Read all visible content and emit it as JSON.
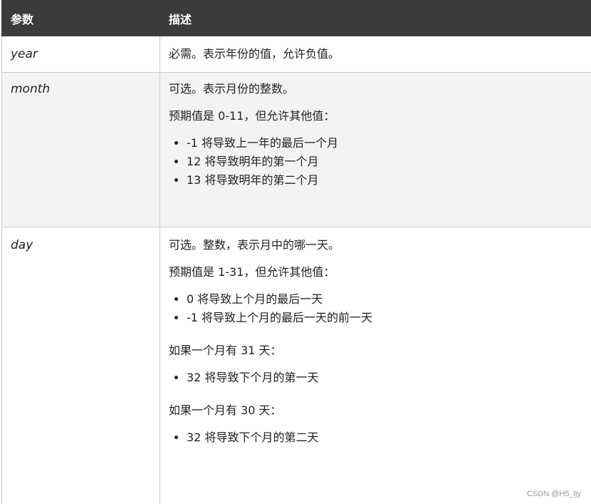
{
  "table": {
    "headers": {
      "param": "参数",
      "desc": "描述"
    },
    "rows": [
      {
        "param": "year",
        "desc": {
          "p1": "必需。表示年份的值，允许负值。"
        }
      },
      {
        "param": "month",
        "desc": {
          "p1": "可选。表示月份的整数。",
          "p2": "预期值是 0-11，但允许其他值：",
          "list": [
            "-1 将导致上一年的最后一个月",
            "12 将导致明年的第一个月",
            "13 将导致明年的第二个月"
          ]
        }
      },
      {
        "param": "day",
        "desc": {
          "p1": "可选。整数，表示月中的哪一天。",
          "p2": "预期值是 1-31，但允许其他值：",
          "list1": [
            "0 将导致上个月的最后一天",
            "-1 将导致上个月的最后一天的前一天"
          ],
          "p3": "如果一个月有 31 天：",
          "list2": [
            "32 将导致下个月的第一天"
          ],
          "p4": "如果一个月有 30 天：",
          "list3": [
            "32 将导致下个月的第二天"
          ]
        }
      }
    ]
  },
  "watermark": "CSDN @H5_ljy"
}
